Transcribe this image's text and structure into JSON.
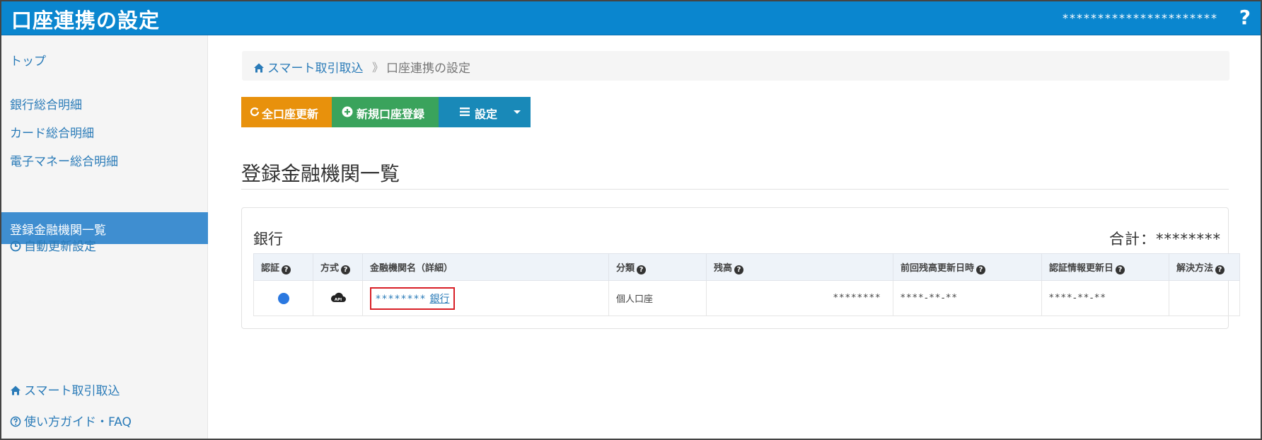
{
  "header": {
    "title": "口座連携の設定",
    "user": "**********************",
    "help": "?"
  },
  "sidebar": {
    "items": [
      {
        "label": "トップ"
      },
      {
        "label": "銀行総合明細"
      },
      {
        "label": "カード総合明細"
      },
      {
        "label": "電子マネー総合明細"
      },
      {
        "label": "登録金融機関一覧",
        "active": true
      },
      {
        "label": "自動更新設定"
      },
      {
        "label": "スマート取引取込"
      },
      {
        "label": "使い方ガイド・FAQ"
      }
    ]
  },
  "breadcrumb": {
    "home": "スマート取引取込",
    "separator": "》",
    "current": "口座連携の設定"
  },
  "toolbar": {
    "refresh": "全口座更新",
    "new_account": "新規口座登録",
    "settings": "設定"
  },
  "page_title": "登録金融機関一覧",
  "panel": {
    "title": "銀行",
    "total": "合計：********"
  },
  "table": {
    "headers": [
      "認証",
      "方式",
      "金融機関名（詳細）",
      "分類",
      "残高",
      "前回残高更新日時",
      "認証情報更新日",
      "解決方法"
    ],
    "rows": [
      {
        "method": "API",
        "name_mask": "********",
        "name_suffix": "銀行",
        "category": "個人口座",
        "balance": "********",
        "last_update": "****-**-**",
        "auth_update": "****-**-**",
        "resolution": ""
      }
    ]
  },
  "colors": {
    "header_bg": "#0a86cf",
    "refresh_btn": "#e8910c",
    "new_btn": "#3aa35c",
    "settings_btn": "#1989b8",
    "active_sidebar": "#3f8ed0",
    "status_dot": "#2a78e0",
    "highlight_box": "#d81f26"
  }
}
